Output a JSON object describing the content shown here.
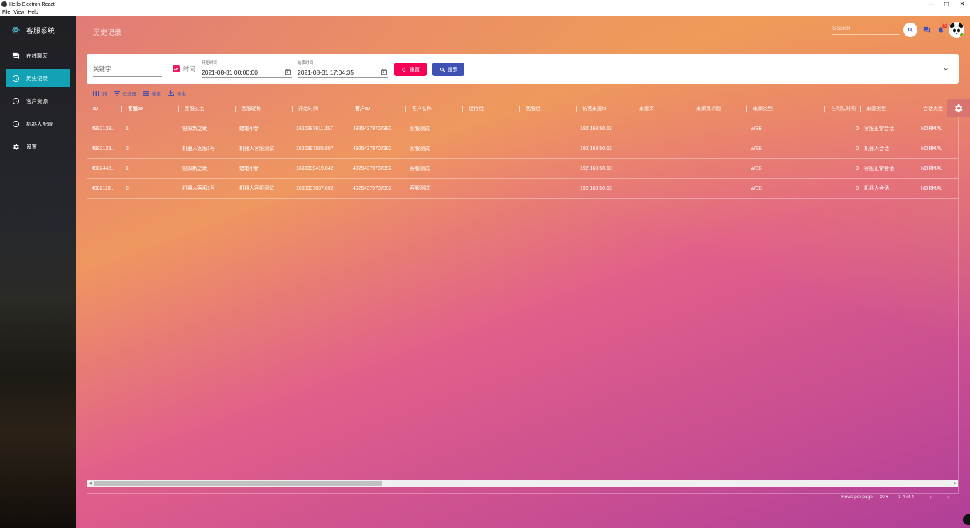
{
  "window": {
    "title": "Hello Electron React!",
    "controls": [
      "—",
      "▢",
      "✕"
    ],
    "menu": [
      "File",
      "View",
      "Help"
    ]
  },
  "sidebar": {
    "brand": "客服系统",
    "items": [
      {
        "label": "在线聊天",
        "icon": "chat-icon",
        "active": false
      },
      {
        "label": "历史记录",
        "icon": "clock-icon",
        "active": true
      },
      {
        "label": "客户资源",
        "icon": "clock-icon",
        "active": false
      },
      {
        "label": "机器人配置",
        "icon": "clock-icon",
        "active": false
      },
      {
        "label": "设置",
        "icon": "gear-icon",
        "active": false
      }
    ]
  },
  "header": {
    "title": "历史记录",
    "search_placeholder": "Search",
    "notification_count": "6"
  },
  "filter": {
    "keyword_placeholder": "关键字",
    "time_label": "时间",
    "time_checked": true,
    "start_label": "开始时间",
    "start_value": "2021-08-31 00:00:00",
    "end_label": "结束时间",
    "end_value": "2021-08-31 17:04:35",
    "reset_label": "重置",
    "search_label": "搜索"
  },
  "toolbar": {
    "columns": "列",
    "filters": "过滤器",
    "density": "密度",
    "export": "导出"
  },
  "table": {
    "columns": [
      "ID",
      "客服ID",
      "客服实名",
      "客服昵称",
      "开始时间",
      "客户ID",
      "客户名称",
      "接待组",
      "客服组",
      "访客来源ip",
      "来源页",
      "来源页标题",
      "来源类型",
      "在列队时间",
      "来源类型",
      "会话类型"
    ],
    "rows": [
      [
        "4982133...",
        "1",
        "野原新之助",
        "蜡笔小新",
        "1630397911.157",
        "49254379707392",
        "客服测试",
        "",
        "",
        "192.168.50.13",
        "",
        "",
        "WEB",
        "0",
        "客服正常会话",
        "NORMAL"
      ],
      [
        "4982128...",
        "2",
        "机器人客服1号",
        "机器人客服测试",
        "1630397885.807",
        "49254379707392",
        "客服测试",
        "",
        "",
        "192.168.50.13",
        "",
        "",
        "WEB",
        "0",
        "机器人会话",
        "NORMAL"
      ],
      [
        "4982442...",
        "1",
        "野原新之助",
        "蜡笔小新",
        "1630399419.842",
        "49254379707392",
        "客服测试",
        "",
        "",
        "192.168.50.13",
        "",
        "",
        "WEB",
        "0",
        "客服正常会话",
        "NORMAL"
      ],
      [
        "4982118...",
        "2",
        "机器人客服1号",
        "机器人客服测试",
        "1630397837.692",
        "49254379707392",
        "客服测试",
        "",
        "",
        "192.168.50.13",
        "",
        "",
        "WEB",
        "0",
        "机器人会话",
        "NORMAL"
      ]
    ]
  },
  "pagination": {
    "rows_per_page_label": "Rows per page:",
    "rows_per_page": "20",
    "range": "1-4 of 4",
    "prev": "‹",
    "next": "›"
  },
  "colors": {
    "active_nav": "#12a1b5",
    "reset_button": "#f50057",
    "search_button": "#3f51b5",
    "checkbox": "#e91e63"
  }
}
